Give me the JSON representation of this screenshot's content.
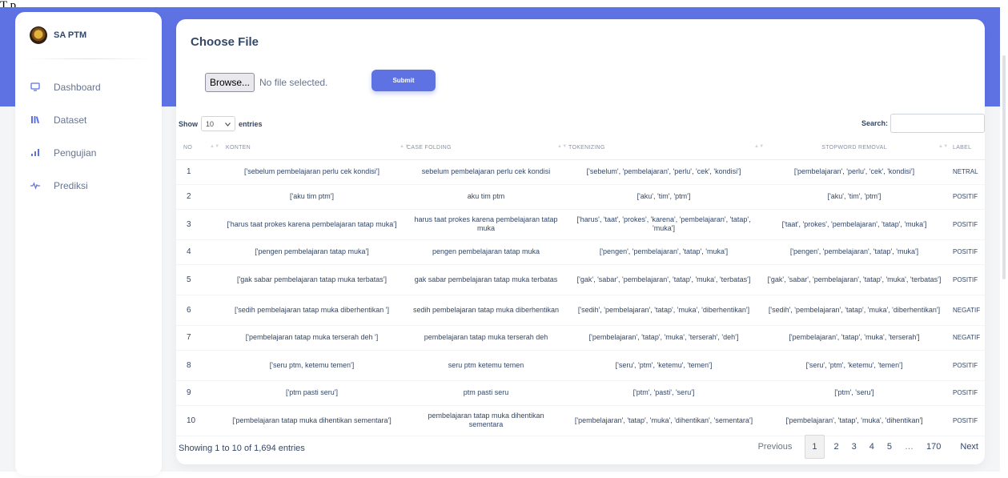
{
  "page_label": "T p",
  "sidebar": {
    "brand": "SA PTM",
    "items": [
      {
        "label": "Dashboard",
        "icon": "monitor-icon"
      },
      {
        "label": "Dataset",
        "icon": "library-icon"
      },
      {
        "label": "Pengujian",
        "icon": "bar-chart-icon"
      },
      {
        "label": "Prediksi",
        "icon": "pulse-icon"
      }
    ]
  },
  "card": {
    "title": "Choose File",
    "browse_label": "Browse...",
    "file_status": "No file selected.",
    "submit_label": "Submit"
  },
  "table_controls": {
    "show_label": "Show",
    "entries_value": "10",
    "entries_label": "entries",
    "search_label": "Search:"
  },
  "table": {
    "headers": [
      "NO",
      "KONTEN",
      "CASE FOLDING",
      "TOKENIZING",
      "STOPWORD REMOVAL",
      "LABEL"
    ],
    "rows": [
      {
        "no": "1",
        "konten": "['sebelum pembelajaran perlu cek kondisi']",
        "case_folding": "sebelum pembelajaran perlu cek kondisi",
        "tokenizing": "['sebelum', 'pembelajaran', 'perlu', 'cek', 'kondisi']",
        "stopword": "['pembelajaran', 'perlu', 'cek', 'kondisi']",
        "label": "NETRAL"
      },
      {
        "no": "2",
        "konten": "['aku tim ptm']",
        "case_folding": "aku tim ptm",
        "tokenizing": "['aku', 'tim', 'ptm']",
        "stopword": "['aku', 'tim', 'ptm']",
        "label": "POSITIF"
      },
      {
        "no": "3",
        "konten": "['harus taat prokes karena pembelajaran tatap muka']",
        "case_folding": "harus taat prokes karena pembelajaran tatap muka",
        "tokenizing": "['harus', 'taat', 'prokes', 'karena', 'pembelajaran', 'tatap', 'muka']",
        "stopword": "['taat', 'prokes', 'pembelajaran', 'tatap', 'muka']",
        "label": "POSITIF"
      },
      {
        "no": "4",
        "konten": "['pengen pembelajaran tatap muka']",
        "case_folding": "pengen pembelajaran tatap muka",
        "tokenizing": "['pengen', 'pembelajaran', 'tatap', 'muka']",
        "stopword": "['pengen', 'pembelajaran', 'tatap', 'muka']",
        "label": "POSITIF"
      },
      {
        "no": "5",
        "konten": "['gak sabar pembelajaran tatap muka terbatas']",
        "case_folding": "gak sabar pembelajaran tatap muka terbatas",
        "tokenizing": "['gak', 'sabar', 'pembelajaran', 'tatap', 'muka', 'terbatas']",
        "stopword": "['gak', 'sabar', 'pembelajaran', 'tatap', 'muka', 'terbatas']",
        "label": "POSITIF"
      },
      {
        "no": "6",
        "konten": "['sedih pembelajaran tatap muka diberhentikan ']",
        "case_folding": "sedih pembelajaran tatap muka diberhentikan",
        "tokenizing": "['sedih', 'pembelajaran', 'tatap', 'muka', 'diberhentikan']",
        "stopword": "['sedih', 'pembelajaran', 'tatap', 'muka', 'diberhentikan']",
        "label": "NEGATIF"
      },
      {
        "no": "7",
        "konten": "['pembelajaran tatap muka terserah deh ']",
        "case_folding": "pembelajaran tatap muka terserah deh",
        "tokenizing": "['pembelajaran', 'tatap', 'muka', 'terserah', 'deh']",
        "stopword": "['pembelajaran', 'tatap', 'muka', 'terserah']",
        "label": "NEGATIF"
      },
      {
        "no": "8",
        "konten": "['seru ptm, ketemu temen']",
        "case_folding": "seru ptm ketemu temen",
        "tokenizing": "['seru', 'ptm', 'ketemu', 'temen']",
        "stopword": "['seru', 'ptm', 'ketemu', 'temen']",
        "label": "POSITIF"
      },
      {
        "no": "9",
        "konten": "['ptm pasti seru']",
        "case_folding": "ptm pasti seru",
        "tokenizing": "['ptm', 'pasti', 'seru']",
        "stopword": "['ptm', 'seru']",
        "label": "POSITIF"
      },
      {
        "no": "10",
        "konten": "['pembelajaran tatap muka dihentikan sementara']",
        "case_folding": "pembelajaran tatap muka dihentikan sementara",
        "tokenizing": "['pembelajaran', 'tatap', 'muka', 'dihentikan', 'sementara']",
        "stopword": "['pembelajaran', 'tatap', 'muka', 'dihentikan']",
        "label": "POSITIF"
      }
    ]
  },
  "footer": {
    "info": "Showing 1 to 10 of 1,694 entries",
    "previous": "Previous",
    "pages": [
      "1",
      "2",
      "3",
      "4",
      "5",
      "…",
      "170"
    ],
    "active_page": "1",
    "next": "Next"
  },
  "colors": {
    "primary": "#5e72e4",
    "background": "#f4f5f7",
    "text": "#344767",
    "muted": "#67748e"
  }
}
